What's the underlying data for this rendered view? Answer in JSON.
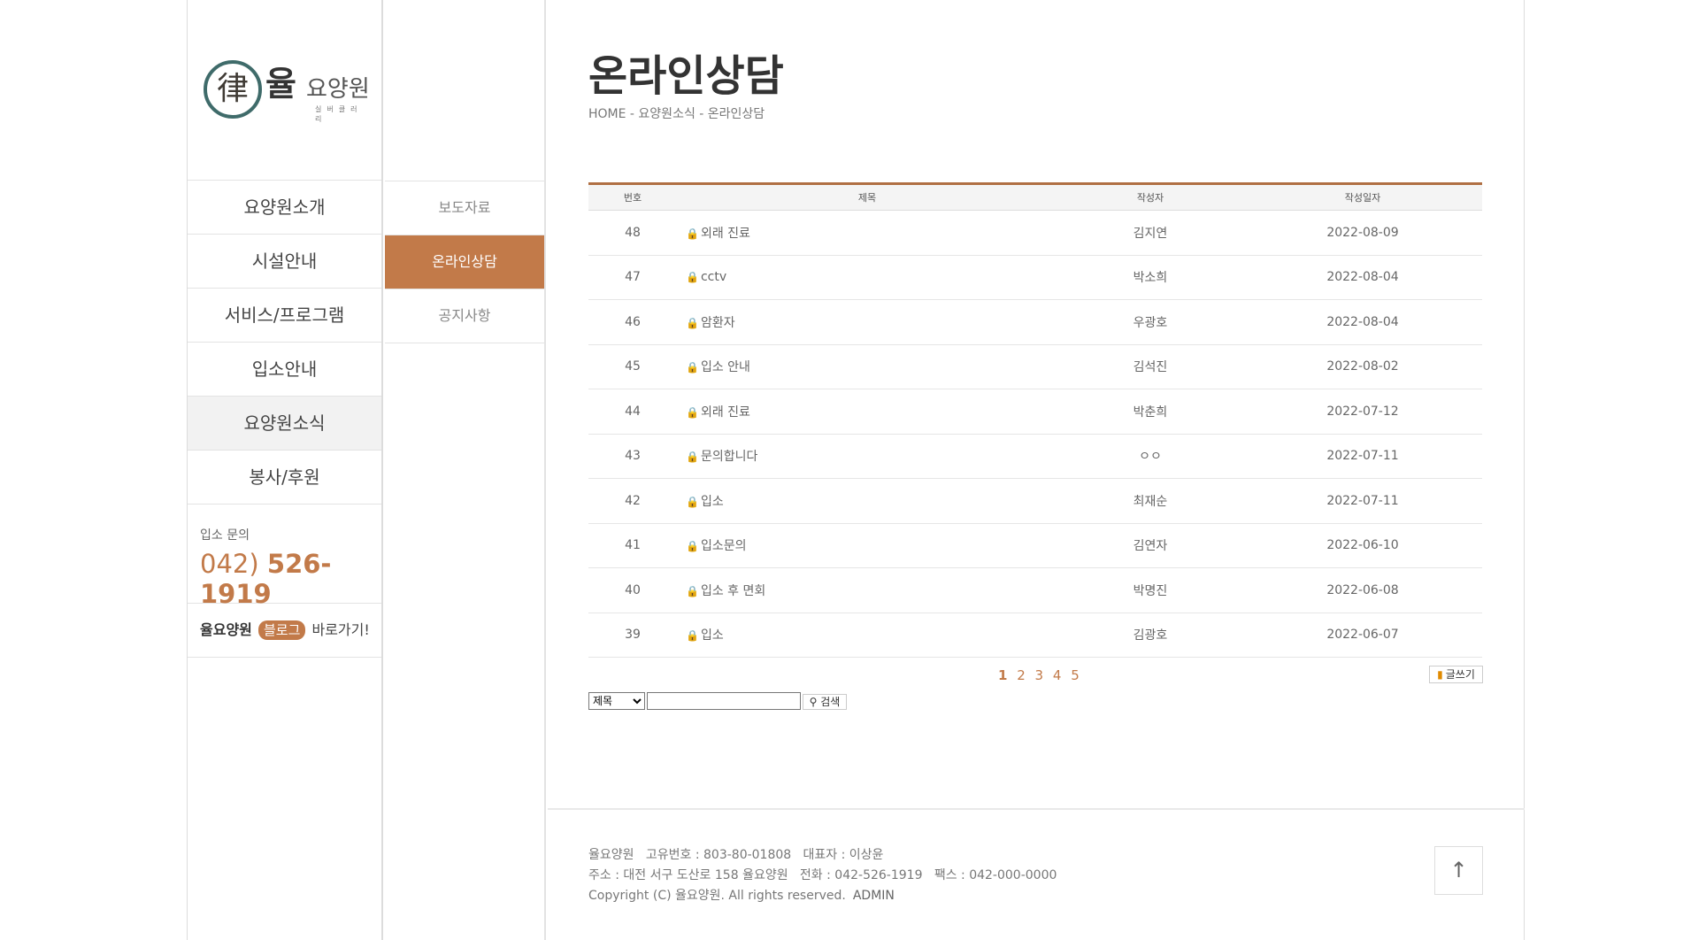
{
  "logo": {
    "mark": "律",
    "main": "율",
    "sub": "요양원",
    "tagline": "실버클러리"
  },
  "main_menu": [
    {
      "label": "요양원소개"
    },
    {
      "label": "시설안내"
    },
    {
      "label": "서비스/프로그램"
    },
    {
      "label": "입소안내"
    },
    {
      "label": "요양원소식"
    },
    {
      "label": "봉사/후원"
    }
  ],
  "inquiry": {
    "label": "입소 문의",
    "area_code": "042)",
    "number": "526-1919"
  },
  "blog": {
    "name": "율요양원",
    "badge": "블로그",
    "suffix": "바로가기!"
  },
  "sub_menu": [
    {
      "label": "보도자료"
    },
    {
      "label": "온라인상담"
    },
    {
      "label": "공지사항"
    }
  ],
  "page": {
    "title": "온라인상담",
    "breadcrumb": "HOME - 요양원소식 - 온라인상담"
  },
  "board": {
    "headers": {
      "num": "번호",
      "subject": "제목",
      "author": "작성자",
      "date": "작성일자"
    },
    "rows": [
      {
        "num": "48",
        "subject": "외래 진료",
        "author": "김지연",
        "date": "2022-08-09"
      },
      {
        "num": "47",
        "subject": "cctv",
        "author": "박소희",
        "date": "2022-08-04"
      },
      {
        "num": "46",
        "subject": "암환자",
        "author": "우광호",
        "date": "2022-08-04"
      },
      {
        "num": "45",
        "subject": "입소 안내",
        "author": "김석진",
        "date": "2022-08-02"
      },
      {
        "num": "44",
        "subject": "외래 진료",
        "author": "박춘희",
        "date": "2022-07-12"
      },
      {
        "num": "43",
        "subject": "문의합니다",
        "author": "ㅇㅇ",
        "date": "2022-07-11"
      },
      {
        "num": "42",
        "subject": "입소",
        "author": "최재순",
        "date": "2022-07-11"
      },
      {
        "num": "41",
        "subject": "입소문의",
        "author": "김연자",
        "date": "2022-06-10"
      },
      {
        "num": "40",
        "subject": "입소 후 면회",
        "author": "박명진",
        "date": "2022-06-08"
      },
      {
        "num": "39",
        "subject": "입소",
        "author": "김광호",
        "date": "2022-06-07"
      }
    ]
  },
  "pager": {
    "pages": [
      "1",
      "2",
      "3",
      "4",
      "5"
    ],
    "current": "1"
  },
  "write_button": "글쓰기",
  "search": {
    "field_selected": "제목",
    "query": "",
    "button": "검색"
  },
  "footer": {
    "line1": "율요양원   고유번호 : 803-80-01808   대표자 : 이상윤",
    "line2": "주소 : 대전 서구 도산로 158 율요양원   전화 : 042-526-1919   팩스 : 042-000-0000",
    "line3": "Copyright (C) 율요양원. All rights reserved.",
    "admin": "ADMIN"
  },
  "top_button": "↑",
  "colors": {
    "accent": "#c27a49",
    "table_border": "#b06f43"
  }
}
